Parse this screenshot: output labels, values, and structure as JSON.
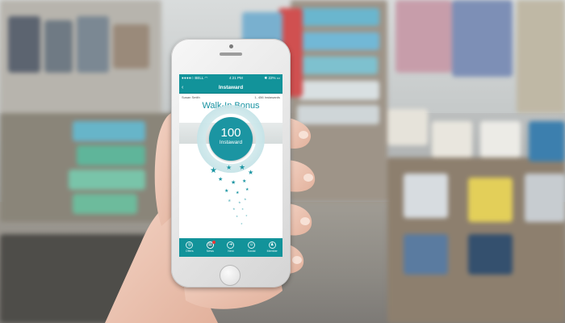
{
  "status_bar": {
    "carrier": "BELL",
    "time": "4:21 PM",
    "battery": "22%"
  },
  "app_bar": {
    "title": "Instaward"
  },
  "info_bar": {
    "user": "Susan Smith",
    "balance": "1, 456 Instawards"
  },
  "screen": {
    "heading": "Walk-In Bonus",
    "award_value": "100",
    "award_unit": "Instaward"
  },
  "tabs": [
    {
      "label": "Offers",
      "icon": "offers-icon"
    },
    {
      "label": "News",
      "icon": "news-icon"
    },
    {
      "label": "Next",
      "icon": "next-icon"
    },
    {
      "label": "Social",
      "icon": "social-icon"
    },
    {
      "label": "Member",
      "icon": "member-icon"
    }
  ],
  "colors": {
    "brand": "#12939a",
    "badge": "#1b95a2",
    "heading": "#1792a1"
  }
}
